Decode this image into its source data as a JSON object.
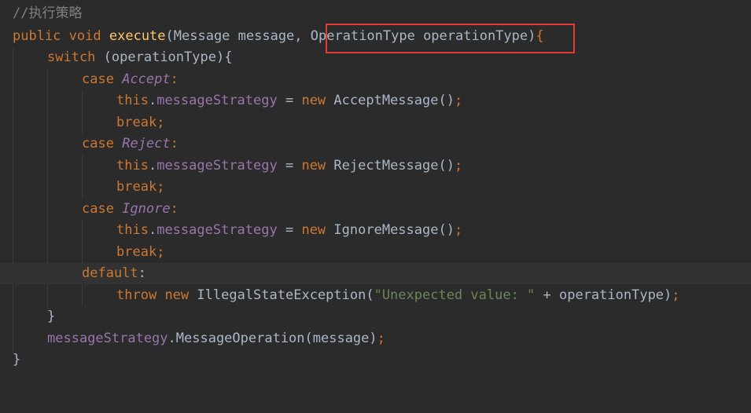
{
  "comment": "//执行策略",
  "signature": {
    "kw_public": "public",
    "kw_void": "void",
    "method": "execute",
    "open": "(Message message,",
    "param2": "OperationType operationType",
    "close_paren": ")",
    "brace": "{"
  },
  "switch_line": {
    "kw": "switch",
    "rest": "(operationType){"
  },
  "cases": [
    {
      "kw_case": "case",
      "label": "Accept",
      "colon": ":",
      "kw_this": "this",
      "dot": ".",
      "field": "messageStrategy",
      "assign": " = ",
      "kw_new": "new",
      "ctor": "AcceptMessage()",
      "semi": ";",
      "kw_break": "break",
      "break_semi": ";"
    },
    {
      "kw_case": "case",
      "label": "Reject",
      "colon": ":",
      "kw_this": "this",
      "dot": ".",
      "field": "messageStrategy",
      "assign": " = ",
      "kw_new": "new",
      "ctor": "RejectMessage()",
      "semi": ";",
      "kw_break": "break",
      "break_semi": ";"
    },
    {
      "kw_case": "case",
      "label": "Ignore",
      "colon": ":",
      "kw_this": "this",
      "dot": ".",
      "field": "messageStrategy",
      "assign": " = ",
      "kw_new": "new",
      "ctor": "IgnoreMessage()",
      "semi": ";",
      "kw_break": "break",
      "break_semi": ";"
    }
  ],
  "default_line": {
    "kw": "default",
    "colon": ":"
  },
  "throw_line": {
    "kw_throw": "throw",
    "kw_new": "new",
    "cls": "IllegalStateException(",
    "str": "\"Unexpected value: \"",
    "rest": " + operationType)",
    "semi": ";"
  },
  "close_switch": "}",
  "call_line": {
    "field": "messageStrategy",
    "rest": ".MessageOperation(message)",
    "semi": ";"
  },
  "close_method": "}",
  "colors": {
    "background": "#2b2b2b",
    "keyword": "#cc7832",
    "method": "#ffc66d",
    "field": "#9876aa",
    "string": "#6a8759",
    "comment": "#808080",
    "text": "#a9b7c6",
    "highlight_border": "#e53935"
  }
}
